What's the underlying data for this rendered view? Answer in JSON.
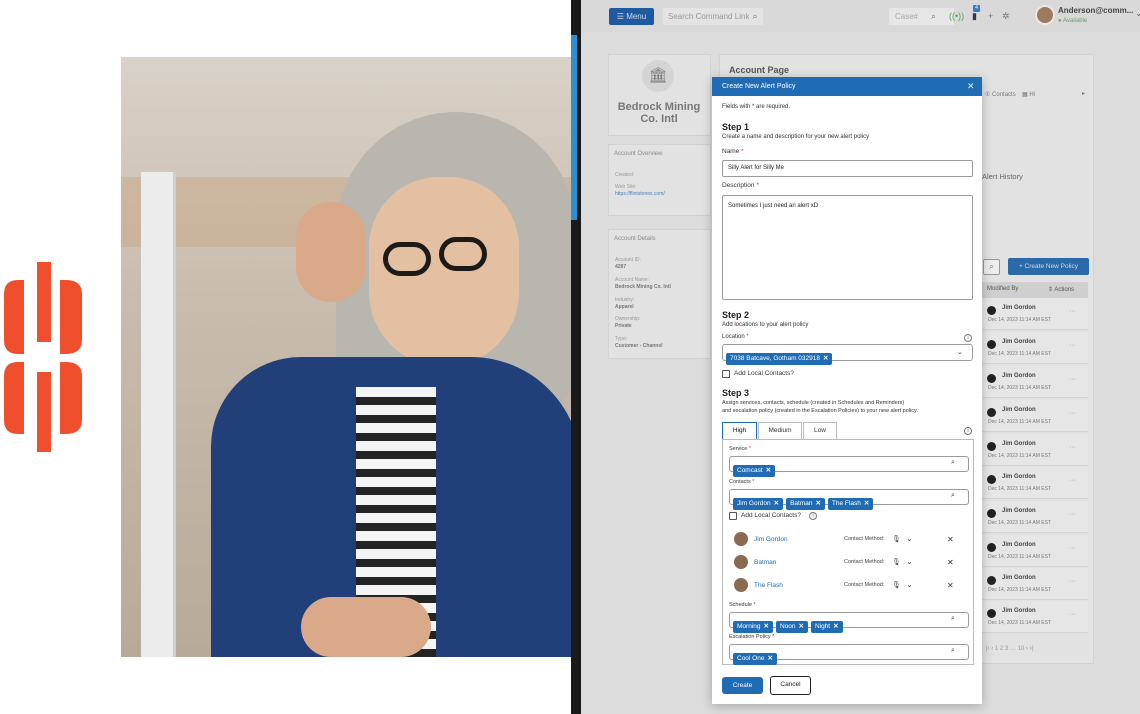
{
  "brand": {
    "accent": "#ef4f2c"
  },
  "photo": {
    "subject": "woman-with-glasses"
  },
  "topbar": {
    "menu_label": "☰ Menu",
    "search_placeholder": "Search Command Link",
    "case_placeholder": "Case#",
    "badge_count": "4",
    "user_name": "Anderson@comm...",
    "user_status": "● Available"
  },
  "account": {
    "name_line1": "Bedrock Mining",
    "name_line2": "Co. Intl",
    "overview_title": "Account Overview",
    "created_label": "Created:",
    "website_label": "Web Site:",
    "website": "https://flintstones.com/",
    "details_title": "Account Details",
    "id_label": "Account ID:",
    "id": "4287",
    "acct_name_label": "Account Name:",
    "acct_name": "Bedrock Mining Co. Intl",
    "industry_label": "Industry:",
    "industry": "Apparel",
    "ownership_label": "Ownership:",
    "ownership": "Private",
    "type_label": "Type:",
    "type": "Customer - Channel"
  },
  "page": {
    "title": "Account Page",
    "contacts_tab": "① Contacts",
    "hi_tab": "▦ Hi",
    "alert_history": "Alert History",
    "create_policy": "+  Create New Policy",
    "col_modified": "Modified By",
    "col_actions": "⇕  Actions",
    "rows": [
      {
        "name": "Jim Gordon",
        "date": "Dec 14, 2023 11:14 AM EST"
      },
      {
        "name": "Jim Gordon",
        "date": "Dec 14, 2023 11:14 AM EST"
      },
      {
        "name": "Jim Gordon",
        "date": "Dec 14, 2023 11:14 AM EST"
      },
      {
        "name": "Jim Gordon",
        "date": "Dec 14, 2023 11:14 AM EST"
      },
      {
        "name": "Jim Gordon",
        "date": "Dec 14, 2023 11:14 AM EST"
      },
      {
        "name": "Jim Gordon",
        "date": "Dec 14, 2023 11:14 AM EST"
      },
      {
        "name": "Jim Gordon",
        "date": "Dec 14, 2023 11:14 AM EST"
      },
      {
        "name": "Jim Gordon",
        "date": "Dec 14, 2023 11:14 AM EST"
      },
      {
        "name": "Jim Gordon",
        "date": "Dec 14, 2023 11:14 AM EST"
      },
      {
        "name": "Jim Gordon",
        "date": "Dec 14, 2023 11:14 AM EST"
      }
    ],
    "pager": "|‹  ‹  1  2  3  …  10  ›  ›|"
  },
  "modal": {
    "title": "Create New Alert Policy",
    "required_note": "Fields with * are required.",
    "step1": "Step 1",
    "step1_desc": "Create a name and description for your new alert policy",
    "name_label": "Name",
    "name_value": "Silly Alert for Silly Me",
    "desc_label": "Description",
    "desc_value": "Sometimes I just need an alert xD",
    "step2": "Step 2",
    "step2_desc": "Add locations to your alert policy",
    "location_label": "Location",
    "location_chip": "7038 Batcave, Gotham 032918",
    "add_local": "Add Local Contacts?",
    "step3": "Step 3",
    "step3_desc1": "Assign services, contacts, schedule (created in Schedules and Reminders)",
    "step3_desc2": "and escalation policy (created in the Escalation Policies) to your new alert policy.",
    "tabs": [
      "High",
      "Medium",
      "Low"
    ],
    "service_label": "Service",
    "service_chip": "Comcast",
    "contacts_label": "Contacts",
    "contact_chips": [
      "Jim Gordon",
      "Batman",
      "The Flash"
    ],
    "add_local2": "Add Local Contacts?",
    "contacts": [
      {
        "name": "Jim Gordon",
        "method": "Contact Method:"
      },
      {
        "name": "Batman",
        "method": "Contact Method:"
      },
      {
        "name": "The Flash",
        "method": "Contact Method:"
      }
    ],
    "schedule_label": "Schedule",
    "schedule_chips": [
      "Morning",
      "Noon",
      "Night"
    ],
    "escalation_label": "Escalation Policy",
    "escalation_chip": "Cool One",
    "create_btn": "Create",
    "cancel_btn": "Cancel"
  }
}
